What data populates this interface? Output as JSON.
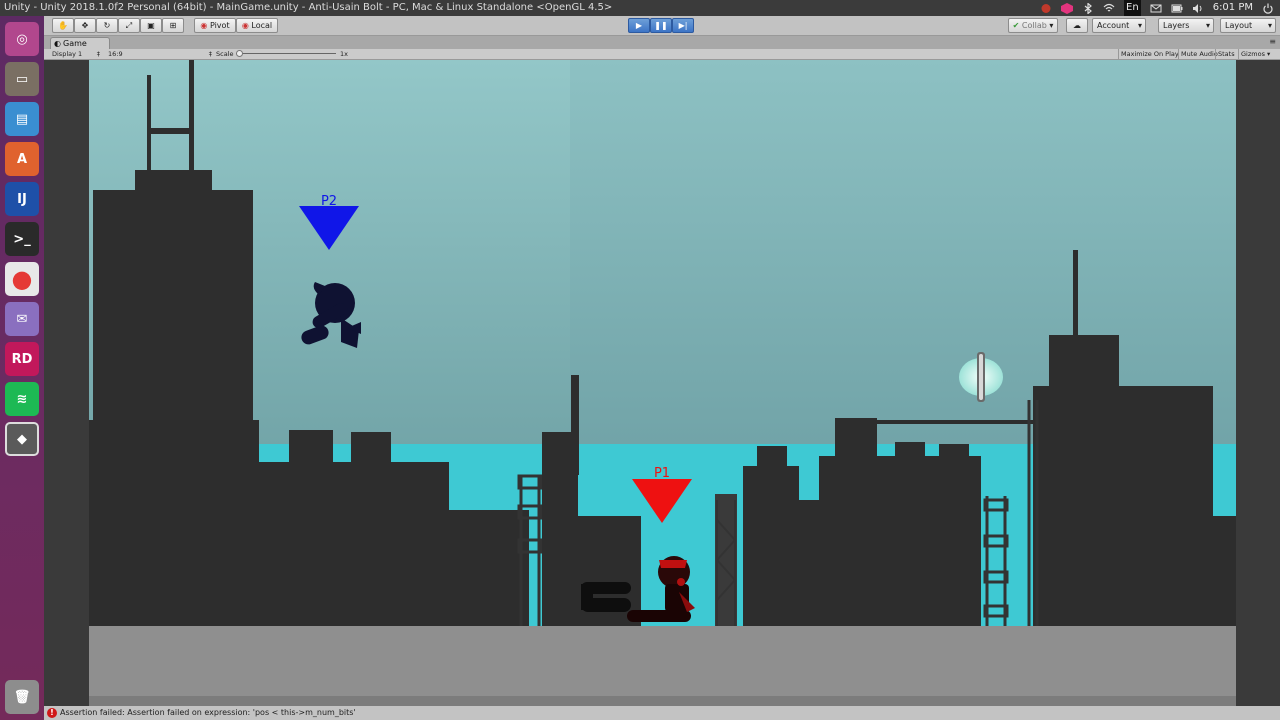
{
  "window": {
    "title": "Unity - Unity 2018.1.0f2 Personal (64bit) - MainGame.unity - Anti-Usain Bolt - PC, Mac & Linux Standalone <OpenGL 4.5>",
    "tray": {
      "keyboard_layout": "En",
      "time": "6:01 PM"
    }
  },
  "launcher": {
    "items": [
      {
        "name": "ubuntu-dash-icon",
        "color": "#b1478d"
      },
      {
        "name": "files-icon",
        "color": "#7a6f63"
      },
      {
        "name": "libreoffice-writer-icon",
        "color": "#3a8ed1"
      },
      {
        "name": "software-center-icon",
        "color": "#e0622e"
      },
      {
        "name": "intellij-icon",
        "color": "#1e50a8"
      },
      {
        "name": "terminal-icon",
        "color": "#2a2a2a"
      },
      {
        "name": "chrome-icon",
        "color": "#e8e8e8"
      },
      {
        "name": "pidgin-icon",
        "color": "#8a6fbf"
      },
      {
        "name": "rider-icon",
        "color": "#c2185b"
      },
      {
        "name": "spotify-icon",
        "color": "#1db954"
      },
      {
        "name": "unity-icon",
        "color": "#5a5a5a"
      },
      {
        "name": "trash-icon",
        "color": "#8d8d8d"
      }
    ]
  },
  "toolbar": {
    "pivot_label": "Pivot",
    "local_label": "Local",
    "collab_label": "Collab",
    "account_label": "Account",
    "layers_label": "Layers",
    "layout_label": "Layout"
  },
  "game_panel": {
    "tab_label": "Game",
    "display_label": "Display 1",
    "aspect_label": "16:9",
    "scale_label": "Scale",
    "scale_value": "1x",
    "maximize_label": "Maximize On Play",
    "mute_label": "Mute Audio",
    "stats_label": "Stats",
    "gizmos_label": "Gizmos"
  },
  "scene": {
    "p2_label": "P2",
    "p1_label": "P1",
    "colors": {
      "sky_top": "#93c7c8",
      "sky_bottom": "#62969a",
      "water": "#3ec9d3",
      "silhouette": "#2d2d2d",
      "ground": "#8f8f8f",
      "p2": "#1016e8",
      "p1": "#ee1111"
    }
  },
  "status": {
    "message": "Assertion failed: Assertion failed on expression: 'pos < this->m_num_bits'"
  }
}
